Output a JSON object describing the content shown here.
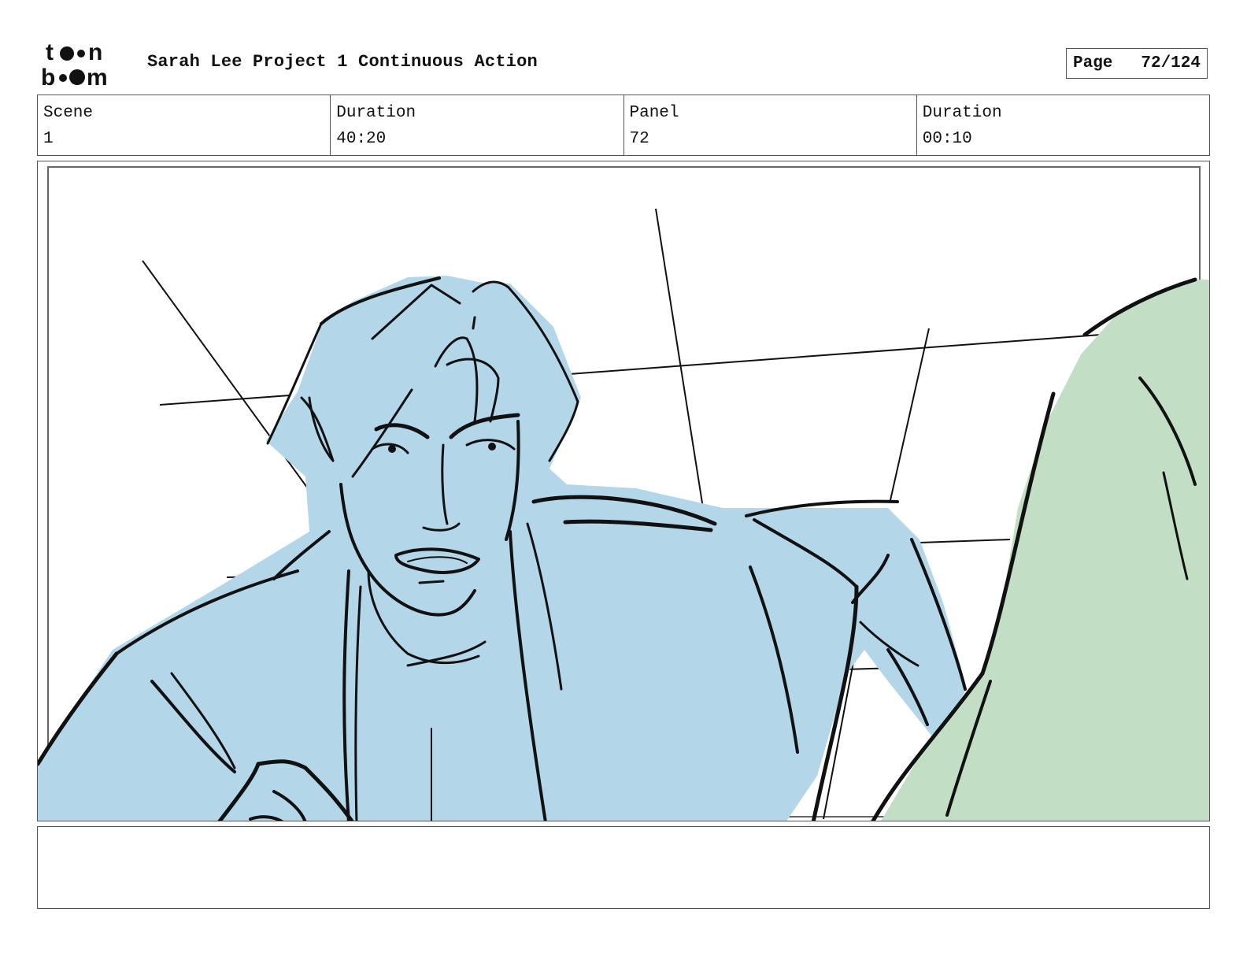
{
  "header": {
    "logo_text": "toon boom",
    "project_title": "Sarah Lee Project 1 Continuous Action",
    "page_label": "Page",
    "page_number": "72/124"
  },
  "info": {
    "scene_label": "Scene",
    "scene_value": "1",
    "scene_duration_label": "Duration",
    "scene_duration_value": "40:20",
    "panel_label": "Panel",
    "panel_value": "72",
    "panel_duration_label": "Duration",
    "panel_duration_value": "00:10"
  },
  "panel_image": {
    "colors": {
      "character_fill": "#b3d6e9",
      "foreground_fill": "#c2dfc6",
      "line": "#111111"
    }
  },
  "notes": {
    "text": ""
  }
}
